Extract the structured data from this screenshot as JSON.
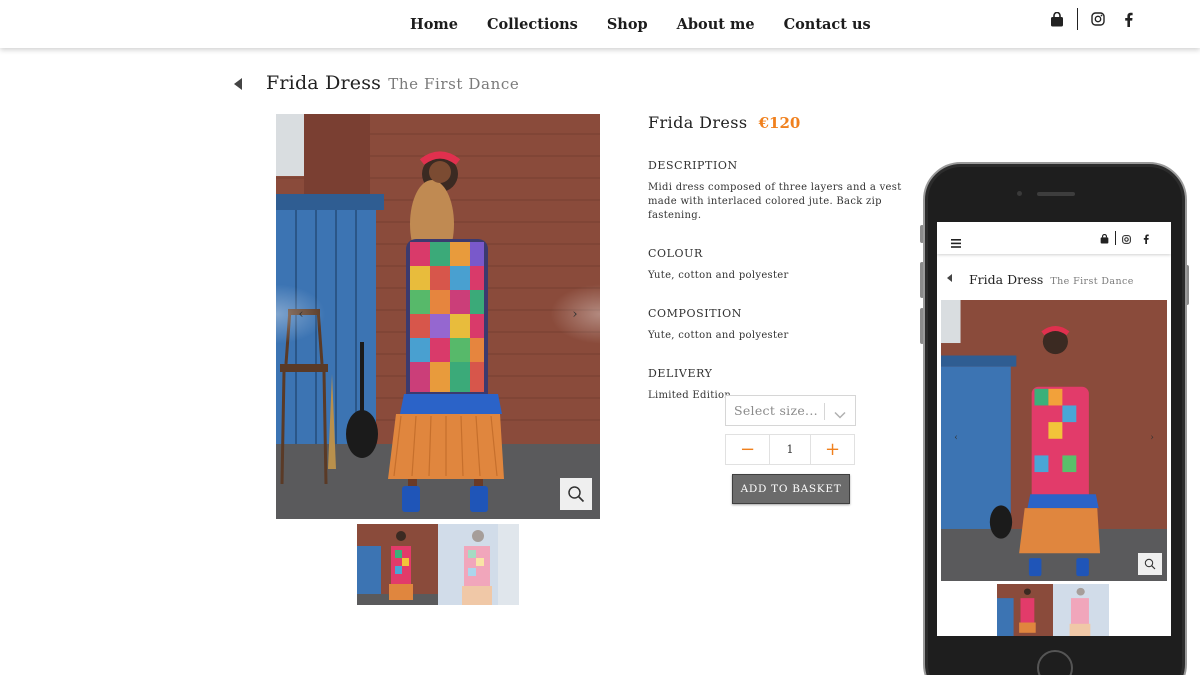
{
  "nav": {
    "items": [
      "Home",
      "Collections",
      "Shop",
      "About me",
      "Contact us"
    ]
  },
  "icons": {
    "basket": "shopping-bag-icon",
    "instagram": "instagram-icon",
    "facebook": "facebook-icon",
    "back": "back-arrow-icon",
    "zoom": "magnifier-icon",
    "menu": "hamburger-icon"
  },
  "product": {
    "name": "Frida Dress",
    "collection": "The First Dance",
    "price": "€120",
    "sections": [
      {
        "heading": "DESCRIPTION",
        "text": "Midi dress composed of three layers and a vest made with interlaced colored jute. Back zip fastening."
      },
      {
        "heading": "COLOUR",
        "text": "Yute, cotton and polyester"
      },
      {
        "heading": "COMPOSITION",
        "text": "Yute, cotton and polyester"
      },
      {
        "heading": "DELIVERY",
        "text": "Limited Edition"
      }
    ],
    "size_placeholder": "Select size...",
    "quantity": "1",
    "minus": "−",
    "plus": "+",
    "add_to_basket": "ADD TO BASKET",
    "carousel_prev": "‹",
    "carousel_next": "›"
  },
  "colors": {
    "accent": "#f0801d",
    "button": "#6b6b6b",
    "brick": "#8c4a3a",
    "door_blue": "#3c74b3"
  }
}
